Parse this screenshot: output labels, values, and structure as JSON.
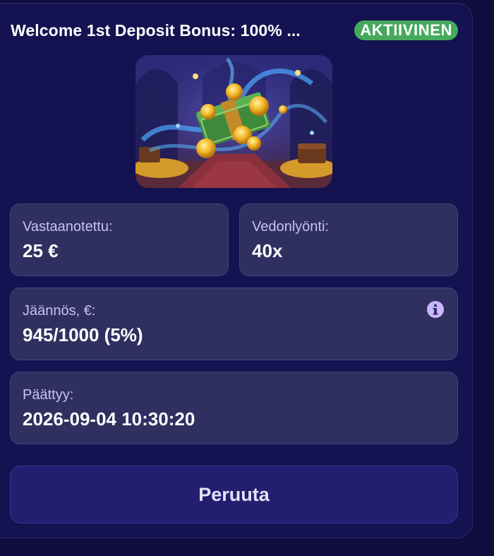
{
  "bonus": {
    "title": "Welcome 1st Deposit Bonus: 100% ...",
    "status": "AKTIIVINEN"
  },
  "stats": {
    "received": {
      "label": "Vastaanotettu:",
      "value": "25 €"
    },
    "wagering": {
      "label": "Vedonlyönti:",
      "value": "40x"
    },
    "remaining": {
      "label": "Jäännös, €:",
      "value": "945/1000 (5%)"
    },
    "expires": {
      "label": "Päättyy:",
      "value": "2026-09-04 10:30:20"
    }
  },
  "actions": {
    "cancel_label": "Peruuta"
  },
  "icons": {
    "info": "info-circle-icon",
    "banner": "treasure-money-banner"
  },
  "colors": {
    "background": "#0e0d3e",
    "card": "#141250",
    "box": "#2f2f60",
    "badge": "#46a95d",
    "button": "#231e70",
    "info_icon": "#c9b6ff"
  }
}
